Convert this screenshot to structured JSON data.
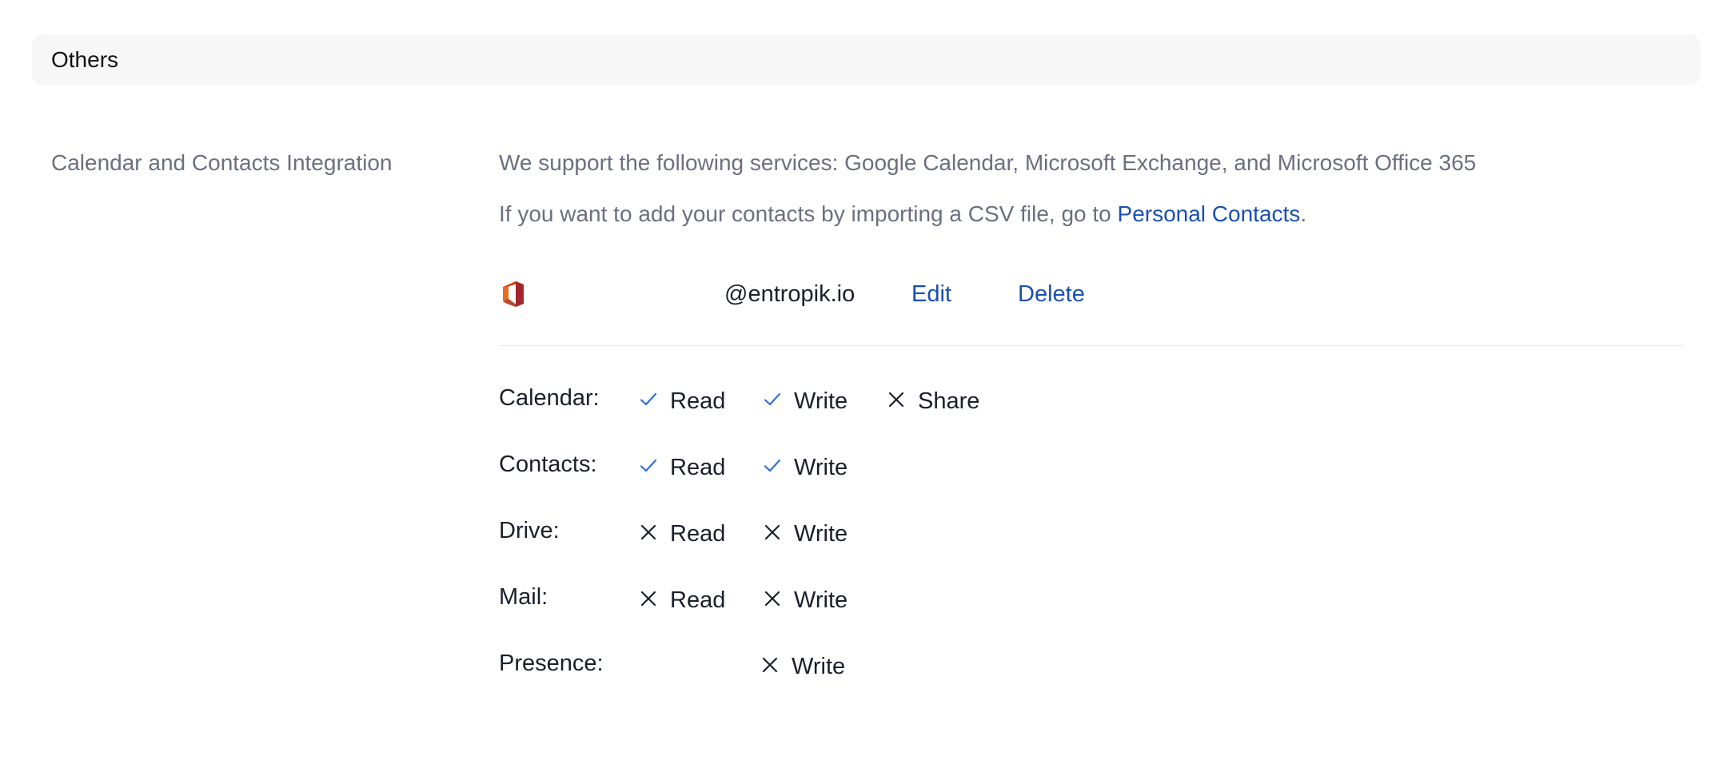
{
  "section": {
    "title": "Others"
  },
  "integration": {
    "label": "Calendar and Contacts Integration",
    "description": "We support the following services: Google Calendar, Microsoft Exchange, and Microsoft Office 365",
    "csv_prefix": "If you want to add your contacts by importing a CSV file, go to ",
    "csv_link": "Personal Contacts",
    "csv_suffix": "."
  },
  "account": {
    "service_icon": "microsoft-office-icon",
    "email": "@entropik.io",
    "edit_label": "Edit",
    "delete_label": "Delete"
  },
  "permissions": [
    {
      "label": "Calendar:",
      "items": [
        {
          "label": "Read",
          "granted": true
        },
        {
          "label": "Write",
          "granted": true
        },
        {
          "label": "Share",
          "granted": false
        }
      ]
    },
    {
      "label": "Contacts:",
      "items": [
        {
          "label": "Read",
          "granted": true
        },
        {
          "label": "Write",
          "granted": true
        }
      ]
    },
    {
      "label": "Drive:",
      "items": [
        {
          "label": "Read",
          "granted": false
        },
        {
          "label": "Write",
          "granted": false
        }
      ]
    },
    {
      "label": "Mail:",
      "items": [
        {
          "label": "Read",
          "granted": false
        },
        {
          "label": "Write",
          "granted": false
        }
      ]
    },
    {
      "label": "Presence:",
      "items": [
        {
          "label": "Write",
          "granted": false
        }
      ]
    }
  ],
  "colors": {
    "granted": "#2f6fdb",
    "denied": "#1b1f2b",
    "link": "#1a4fb0"
  }
}
